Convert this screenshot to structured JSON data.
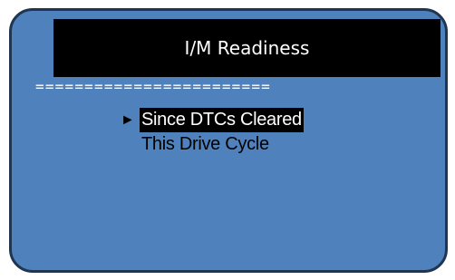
{
  "screen": {
    "title": "I/M Readiness",
    "separator": "========================",
    "menu": {
      "pointer_glyph": "►",
      "items": [
        {
          "label": "Since DTCs Cleared",
          "selected": true
        },
        {
          "label": "This Drive Cycle",
          "selected": false
        }
      ]
    }
  },
  "colors": {
    "screen_background": "#4f81bd",
    "screen_border": "#1f3550",
    "title_background": "#000000",
    "title_text": "#ffffff",
    "selected_background": "#000000",
    "selected_text": "#ffffff",
    "menu_text": "#000000"
  }
}
